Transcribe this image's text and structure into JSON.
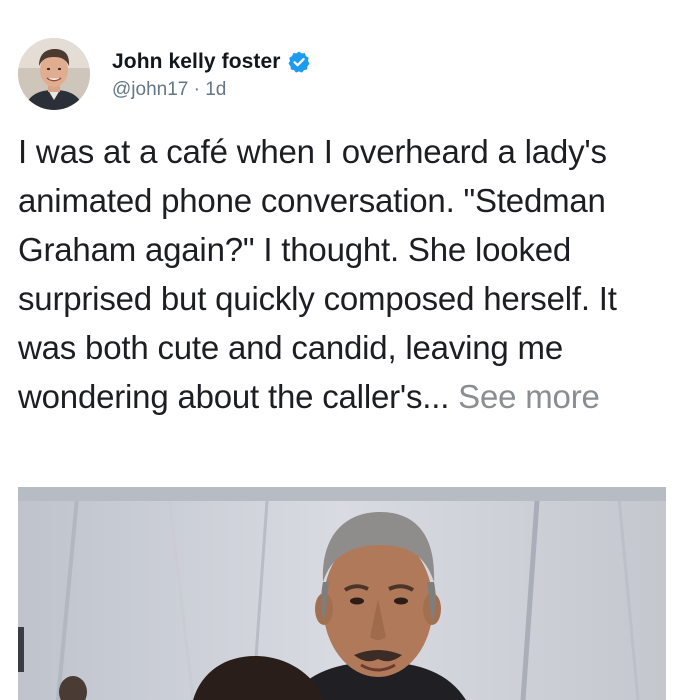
{
  "post": {
    "author_name": "John kelly foster",
    "handle": "@john17",
    "separator": " · ",
    "time": "1d",
    "verified": true,
    "text": "I was at a café when I overheard a lady's animated phone conversation. \"Stedman Graham again?\" I thought. She looked surprised but quickly composed herself. It was both cute and candid, leaving me wondering about the caller's...",
    "see_more_label": "See more"
  },
  "icons": {
    "verified": "verified-badge-icon",
    "avatar": "avatar-photo"
  },
  "colors": {
    "verified_blue": "#1d9bf0",
    "handle_gray": "#657786",
    "see_more_gray": "#8a8d91",
    "text": "#1c1e21"
  }
}
